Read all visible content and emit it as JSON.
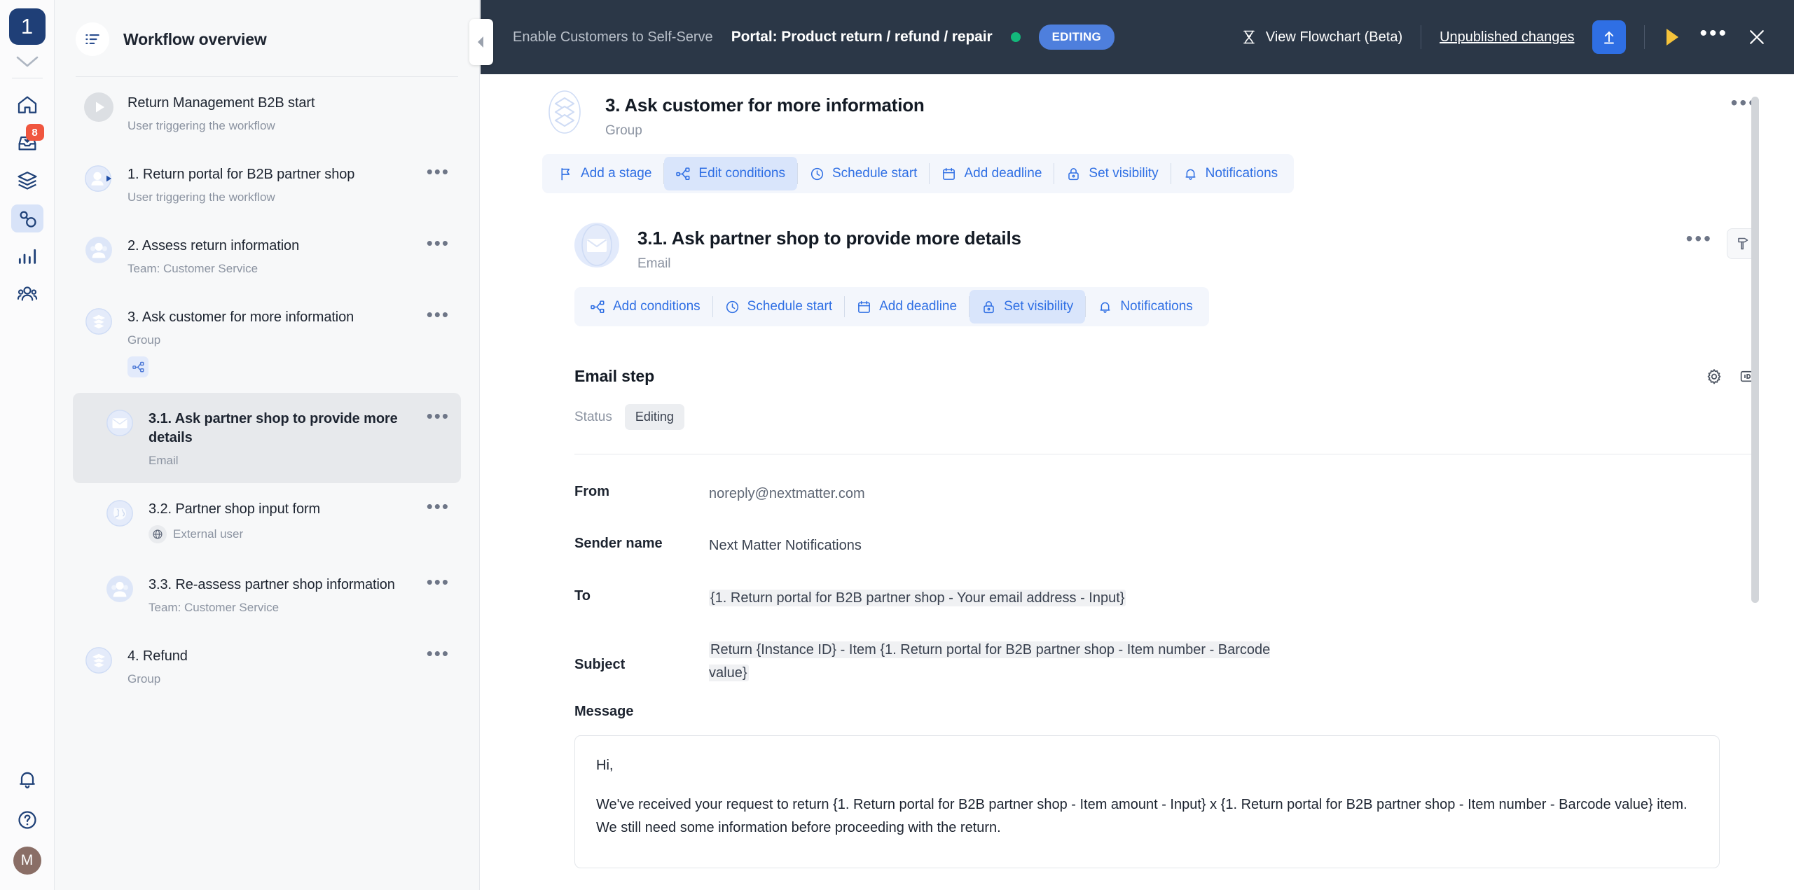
{
  "rail": {
    "logo_label": "1",
    "items": [
      {
        "name": "home",
        "label": "Home",
        "badge": null,
        "active": false
      },
      {
        "name": "inbox",
        "label": "Inbox",
        "badge": "8",
        "active": false
      },
      {
        "name": "layers",
        "label": "Workflows",
        "badge": null,
        "active": false
      },
      {
        "name": "connections",
        "label": "Integrations",
        "badge": null,
        "active": true
      },
      {
        "name": "analytics",
        "label": "Analytics",
        "badge": null,
        "active": false
      },
      {
        "name": "people",
        "label": "Teams",
        "badge": null,
        "active": false
      }
    ],
    "bottom": [
      {
        "name": "notifications",
        "label": "Notifications"
      },
      {
        "name": "help",
        "label": "Help"
      }
    ],
    "avatar_initial": "M"
  },
  "sidebar": {
    "title": "Workflow overview",
    "title_icon": "list-icon",
    "items": [
      {
        "title": "Return Management B2B start",
        "subtitle": "User triggering the workflow",
        "icon": "play-circle-icon",
        "sub": false,
        "selected": false,
        "has_dots": false,
        "has_condition": false,
        "globe": false
      },
      {
        "title": "1. Return portal for B2B partner shop",
        "subtitle": "User triggering the workflow",
        "icon": "user-play-icon",
        "sub": false,
        "selected": false,
        "has_dots": true,
        "has_condition": false,
        "globe": false
      },
      {
        "title": "2. Assess return information",
        "subtitle": "Team: Customer Service",
        "icon": "team-icon",
        "sub": false,
        "selected": false,
        "has_dots": true,
        "has_condition": false,
        "globe": false
      },
      {
        "title": "3. Ask customer for more information",
        "subtitle": "Group",
        "icon": "group-layers-icon",
        "sub": false,
        "selected": false,
        "has_dots": true,
        "has_condition": true,
        "globe": false
      },
      {
        "title": "3.1. Ask partner shop to provide more details",
        "subtitle": "Email",
        "icon": "email-icon",
        "sub": true,
        "selected": true,
        "has_dots": true,
        "has_condition": false,
        "globe": false
      },
      {
        "title": "3.2. Partner shop input form",
        "subtitle": "External user",
        "icon": "globe-icon",
        "sub": true,
        "selected": false,
        "has_dots": true,
        "has_condition": false,
        "globe": true
      },
      {
        "title": "3.3. Re-assess partner shop information",
        "subtitle": "Team: Customer Service",
        "icon": "team-icon",
        "sub": true,
        "selected": false,
        "has_dots": true,
        "has_condition": false,
        "globe": false
      },
      {
        "title": "4. Refund",
        "subtitle": "Group",
        "icon": "group-layers-icon",
        "sub": false,
        "selected": false,
        "has_dots": true,
        "has_condition": false,
        "globe": false
      }
    ]
  },
  "topbar": {
    "breadcrumb": "Enable Customers to Self-Serve",
    "title": "Portal: Product return / refund / repair",
    "status_dot_color": "#13b87b",
    "status_pill": "EDITING",
    "flowchart_label": "View Flowchart (Beta)",
    "unpublished_label": "Unpublished changes",
    "upload_icon": "upload-icon",
    "play_icon": "play-icon",
    "more_icon": "more-horizontal-icon",
    "close_icon": "close-icon",
    "accent_blue": "#2f6fe4",
    "pill_blue": "#4e7fdd",
    "bar_bg": "#2b3747"
  },
  "group": {
    "title": "3. Ask customer for more information",
    "subtitle": "Group",
    "actions": [
      {
        "label": "Add a stage",
        "icon": "flag-icon",
        "highlighted": false
      },
      {
        "label": "Edit conditions",
        "icon": "conditions-icon",
        "highlighted": true
      },
      {
        "label": "Schedule start",
        "icon": "clock-icon",
        "highlighted": false
      },
      {
        "label": "Add deadline",
        "icon": "calendar-icon",
        "highlighted": false
      },
      {
        "label": "Set visibility",
        "icon": "lock-icon",
        "highlighted": false
      },
      {
        "label": "Notifications",
        "icon": "bell-icon",
        "highlighted": false
      }
    ]
  },
  "step": {
    "title": "3.1. Ask partner shop to provide more details",
    "subtitle": "Email",
    "tool_icon": "hammer-icon",
    "more_icon": "more-horizontal-icon",
    "actions": [
      {
        "label": "Add conditions",
        "icon": "conditions-icon",
        "highlighted": false
      },
      {
        "label": "Schedule start",
        "icon": "clock-icon",
        "highlighted": false
      },
      {
        "label": "Add deadline",
        "icon": "calendar-icon",
        "highlighted": false
      },
      {
        "label": "Set visibility",
        "icon": "lock-icon",
        "highlighted": true
      },
      {
        "label": "Notifications",
        "icon": "bell-icon",
        "highlighted": false
      }
    ]
  },
  "email_step": {
    "section_title": "Email step",
    "gear_icon": "gear-icon",
    "id_icon": "id-icon",
    "status_label": "Status",
    "status_value": "Editing",
    "fields": [
      {
        "label": "From",
        "value": "noreply@nextmatter.com",
        "muted": true
      },
      {
        "label": "Sender name",
        "value": "Next Matter Notifications",
        "muted": false
      },
      {
        "label": "To",
        "value": "{1. Return portal for B2B partner shop - Your email address - Input}",
        "muted": false,
        "variable": true
      },
      {
        "label": "Subject",
        "value": "Return {Instance ID} - Item {1. Return portal for B2B partner shop - Item number - Barcode value}",
        "muted": false,
        "variable": true
      }
    ],
    "message_label": "Message",
    "message_paragraphs": [
      "Hi,",
      "We've received your request to return {1. Return portal for B2B partner shop - Item amount - Input} x {1. Return portal for B2B partner shop - Item number - Barcode value} item. We still need some information before proceeding with the return."
    ]
  }
}
